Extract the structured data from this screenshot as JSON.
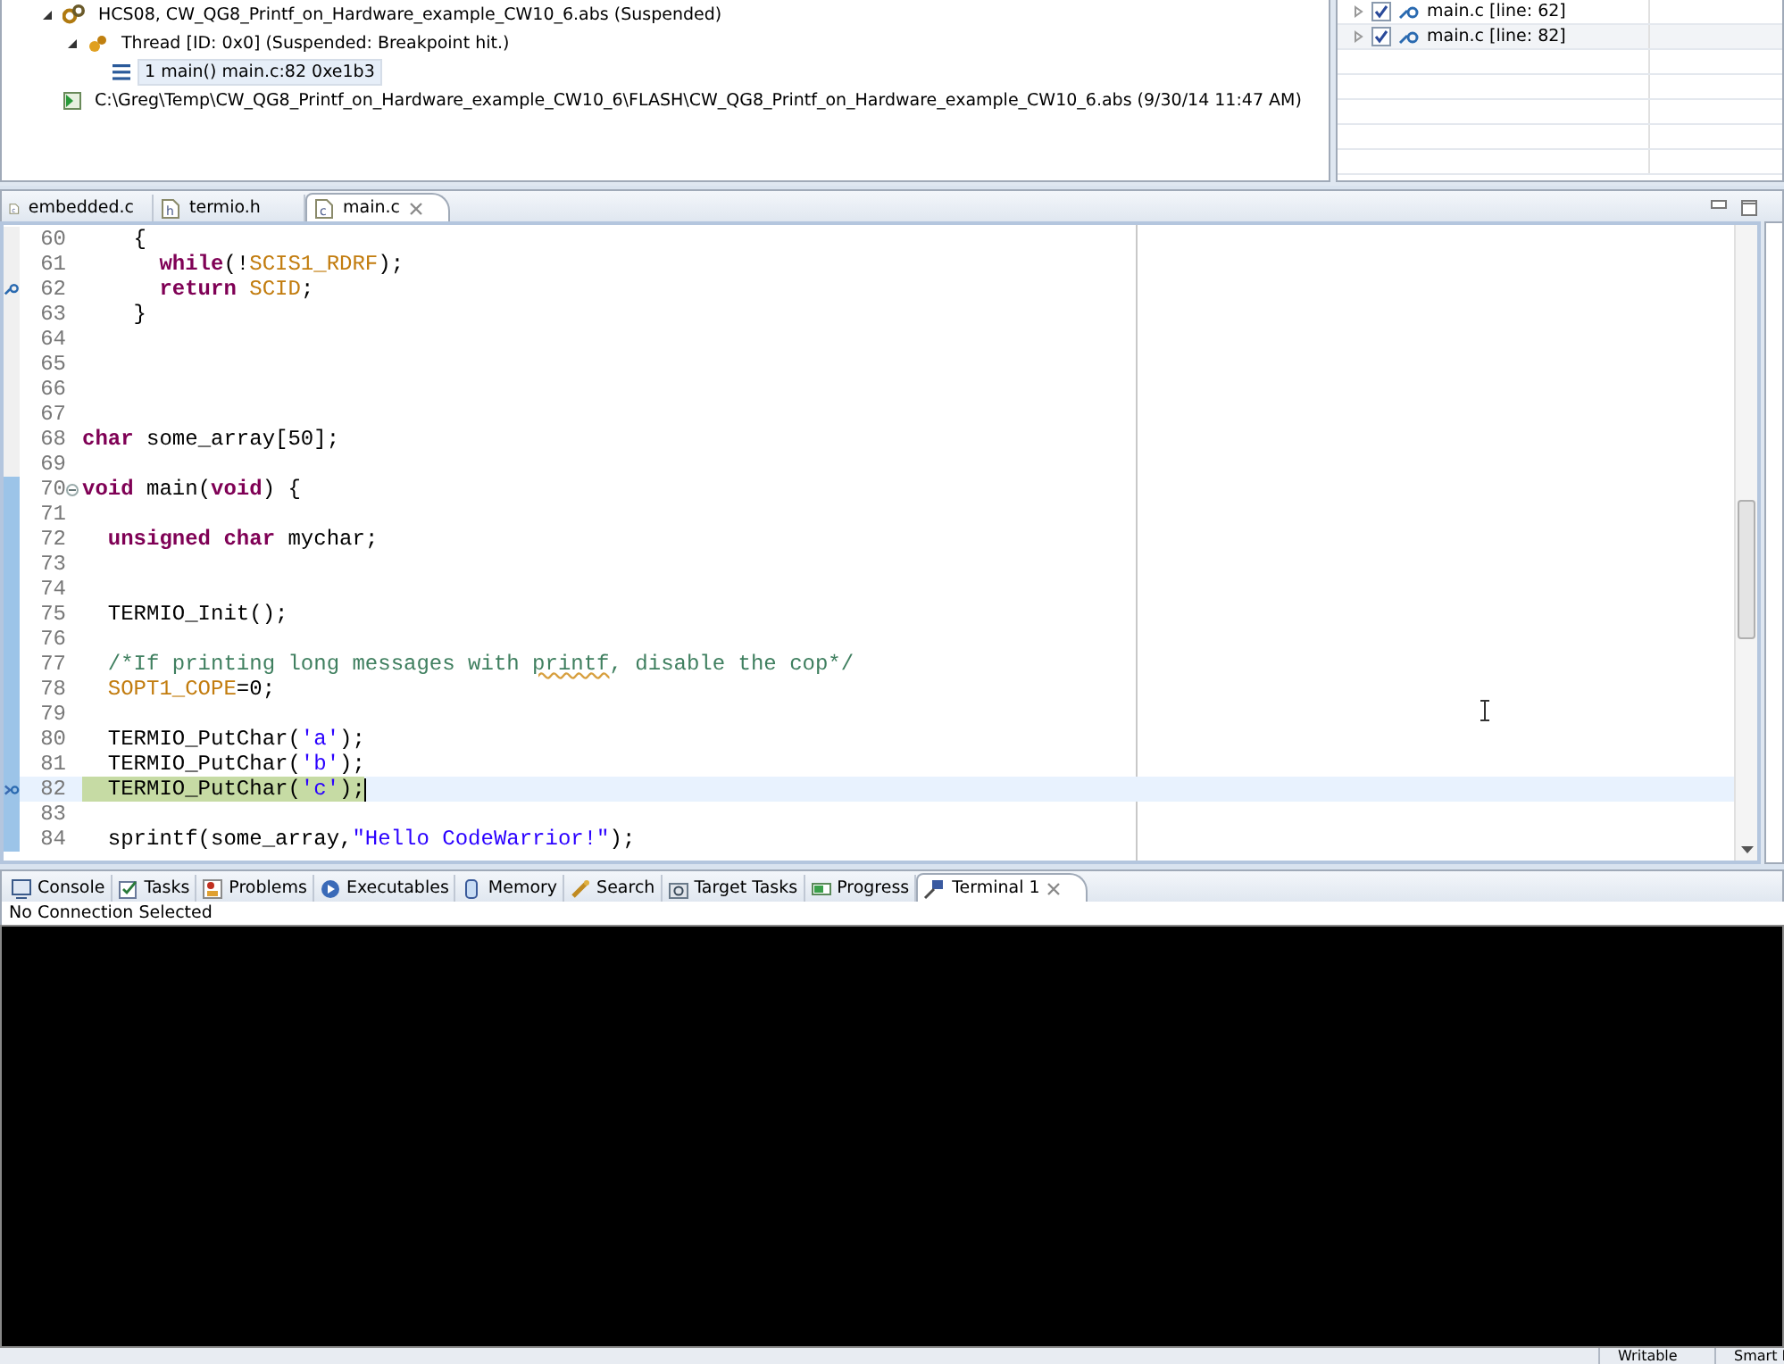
{
  "debug_view": {
    "tree": [
      {
        "kind": "target",
        "label": "HCS08, CW_QG8_Printf_on_Hardware_example_CW10_6.abs (Suspended)",
        "expanded": true,
        "selected": false,
        "children": [
          {
            "kind": "thread",
            "label": "Thread [ID: 0x0] (Suspended: Breakpoint hit.)",
            "expanded": true,
            "selected": false,
            "children": [
              {
                "kind": "frame",
                "label": "1 main() main.c:82 0xe1b3",
                "selected": true
              }
            ]
          }
        ]
      },
      {
        "kind": "process",
        "label": "C:\\Greg\\Temp\\CW_QG8_Printf_on_Hardware_example_CW10_6\\FLASH\\CW_QG8_Printf_on_Hardware_example_CW10_6.abs (9/30/14 11:47 AM)",
        "selected": false
      }
    ]
  },
  "breakpoints": {
    "rows": [
      {
        "label": "main.c [line: 62]",
        "checked": true,
        "expanded": false
      },
      {
        "label": "main.c [line: 82]",
        "checked": true,
        "expanded": false
      }
    ]
  },
  "editor": {
    "tabs": [
      {
        "label": "embedded.c",
        "kind": "c",
        "selected": false
      },
      {
        "label": "termio.h",
        "kind": "h",
        "selected": false
      },
      {
        "label": "main.c",
        "kind": "c",
        "selected": true
      }
    ],
    "lines": [
      {
        "number": "60",
        "current": false,
        "in_scope": false,
        "breakpoint": false,
        "fold": false,
        "tokens": [
          {
            "kind": "plain",
            "text": "    {"
          }
        ]
      },
      {
        "number": "61",
        "current": false,
        "in_scope": false,
        "breakpoint": false,
        "fold": false,
        "tokens": [
          {
            "kind": "keyword",
            "text": "      while"
          },
          {
            "kind": "plain",
            "text": "(!"
          },
          {
            "kind": "macro",
            "text": "SCIS1_RDRF"
          },
          {
            "kind": "plain",
            "text": ");"
          }
        ]
      },
      {
        "number": "62",
        "current": false,
        "in_scope": false,
        "breakpoint": true,
        "fold": false,
        "tokens": [
          {
            "kind": "keyword",
            "text": "      return "
          },
          {
            "kind": "macro",
            "text": "SCID"
          },
          {
            "kind": "plain",
            "text": ";"
          }
        ]
      },
      {
        "number": "63",
        "current": false,
        "in_scope": false,
        "breakpoint": false,
        "fold": false,
        "tokens": [
          {
            "kind": "plain",
            "text": "    }"
          }
        ]
      },
      {
        "number": "64",
        "current": false,
        "in_scope": false,
        "breakpoint": false,
        "fold": false
      },
      {
        "number": "65",
        "current": false,
        "in_scope": false,
        "breakpoint": false,
        "fold": false
      },
      {
        "number": "66",
        "current": false,
        "in_scope": false,
        "breakpoint": false,
        "fold": false
      },
      {
        "number": "67",
        "current": false,
        "in_scope": false,
        "breakpoint": false,
        "fold": false
      },
      {
        "number": "68",
        "current": false,
        "in_scope": false,
        "breakpoint": false,
        "fold": false,
        "tokens": [
          {
            "kind": "keyword",
            "text": "char"
          },
          {
            "kind": "plain",
            "text": " some_array[50];"
          }
        ]
      },
      {
        "number": "69",
        "current": false,
        "in_scope": false,
        "breakpoint": false,
        "fold": false
      },
      {
        "number": "70",
        "current": false,
        "in_scope": true,
        "breakpoint": false,
        "fold": true,
        "tokens": [
          {
            "kind": "keyword",
            "text": "void"
          },
          {
            "kind": "plain",
            "text": " main("
          },
          {
            "kind": "keyword",
            "text": "void"
          },
          {
            "kind": "plain",
            "text": ") {"
          }
        ]
      },
      {
        "number": "71",
        "current": false,
        "in_scope": true,
        "breakpoint": false,
        "fold": false
      },
      {
        "number": "72",
        "current": false,
        "in_scope": true,
        "breakpoint": false,
        "fold": false,
        "tokens": [
          {
            "kind": "keyword",
            "text": "  unsigned char"
          },
          {
            "kind": "plain",
            "text": " mychar;"
          }
        ]
      },
      {
        "number": "73",
        "current": false,
        "in_scope": true,
        "breakpoint": false,
        "fold": false
      },
      {
        "number": "74",
        "current": false,
        "in_scope": true,
        "breakpoint": false,
        "fold": false
      },
      {
        "number": "75",
        "current": false,
        "in_scope": true,
        "breakpoint": false,
        "fold": false,
        "tokens": [
          {
            "kind": "plain",
            "text": "  TERMIO_Init();"
          }
        ]
      },
      {
        "number": "76",
        "current": false,
        "in_scope": true,
        "breakpoint": false,
        "fold": false
      },
      {
        "number": "77",
        "current": false,
        "in_scope": true,
        "breakpoint": false,
        "fold": false,
        "tokens": [
          {
            "kind": "comment",
            "text": "  /*If printing long messages with "
          },
          {
            "kind": "comment-misspelled",
            "text": "printf"
          },
          {
            "kind": "comment",
            "text": ", disable the cop*/"
          }
        ]
      },
      {
        "number": "78",
        "current": false,
        "in_scope": true,
        "breakpoint": false,
        "fold": false,
        "tokens": [
          {
            "kind": "macro",
            "text": "  SOPT1_COPE"
          },
          {
            "kind": "plain",
            "text": "=0;"
          }
        ]
      },
      {
        "number": "79",
        "current": false,
        "in_scope": true,
        "breakpoint": false,
        "fold": false
      },
      {
        "number": "80",
        "current": false,
        "in_scope": true,
        "breakpoint": false,
        "fold": false,
        "tokens": [
          {
            "kind": "plain",
            "text": "  TERMIO_PutChar("
          },
          {
            "kind": "string",
            "text": "'a'"
          },
          {
            "kind": "plain",
            "text": ");"
          }
        ]
      },
      {
        "number": "81",
        "current": false,
        "in_scope": true,
        "breakpoint": false,
        "fold": false,
        "tokens": [
          {
            "kind": "plain",
            "text": "  TERMIO_PutChar("
          },
          {
            "kind": "string",
            "text": "'b'"
          },
          {
            "kind": "plain",
            "text": ");"
          }
        ]
      },
      {
        "number": "82",
        "current": true,
        "in_scope": true,
        "breakpoint": true,
        "fold": false,
        "tokens": [
          {
            "kind": "plain",
            "text": "  TERMIO_PutChar("
          },
          {
            "kind": "string",
            "text": "'c'"
          },
          {
            "kind": "plain",
            "text": ");"
          }
        ]
      },
      {
        "number": "83",
        "current": false,
        "in_scope": true,
        "breakpoint": false,
        "fold": false
      },
      {
        "number": "84",
        "current": false,
        "in_scope": true,
        "breakpoint": false,
        "fold": false,
        "tokens": [
          {
            "kind": "plain",
            "text": "  sprintf(some_array,"
          },
          {
            "kind": "string",
            "text": "\"Hello CodeWarrior!\""
          },
          {
            "kind": "plain",
            "text": ");"
          }
        ]
      }
    ]
  },
  "console": {
    "tabs": [
      {
        "label": "Console",
        "kind": "console",
        "selected": false
      },
      {
        "label": "Tasks",
        "kind": "tasks",
        "selected": false
      },
      {
        "label": "Problems",
        "kind": "problems",
        "selected": false
      },
      {
        "label": "Executables",
        "kind": "executables",
        "selected": false
      },
      {
        "label": "Memory",
        "kind": "memory",
        "selected": false
      },
      {
        "label": "Search",
        "kind": "search",
        "selected": false
      },
      {
        "label": "Target Tasks",
        "kind": "target",
        "selected": false
      },
      {
        "label": "Progress",
        "kind": "progress",
        "selected": false
      },
      {
        "label": "Terminal 1",
        "kind": "terminal",
        "selected": true
      }
    ],
    "status": "No Connection Selected"
  },
  "status_bar": {
    "fields": [
      "Writable",
      "Smart I"
    ]
  }
}
